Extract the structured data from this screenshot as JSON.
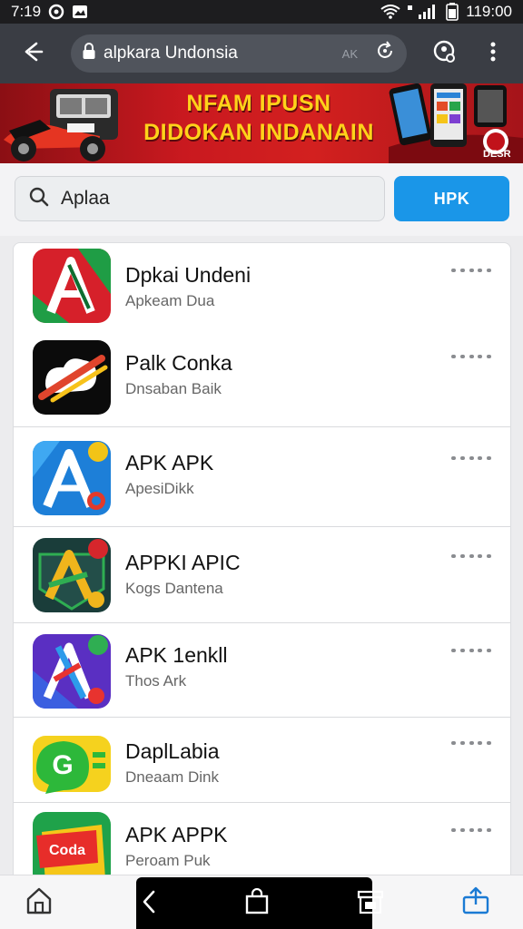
{
  "status_bar": {
    "time_left": "7:19",
    "time_right": "119:00"
  },
  "browser": {
    "url_text": "alpkara Undonsia",
    "url_aux": "AK",
    "icons": [
      "back-icon",
      "lock-icon",
      "refresh-icon",
      "profile-icon",
      "more-vertical-icon"
    ]
  },
  "banner": {
    "line1": "NFAM IPUSN",
    "line2": "DIDOKAN INDANAIN",
    "corner_tag": "DESR"
  },
  "search": {
    "value": "Aplaa",
    "button_label": "HPK"
  },
  "apps": [
    {
      "title": "Dpkai Undeni",
      "subtitle": "Apkeam Dua",
      "icon": "red-green-a-icon",
      "colors": [
        "#d6202a",
        "#1f9d45"
      ]
    },
    {
      "title": "Palk Conka",
      "subtitle": "Dnsaban Baik",
      "icon": "black-swoosh-icon",
      "colors": [
        "#000000",
        "#e0452d",
        "#f7c21a"
      ]
    },
    {
      "title": "APK APK",
      "subtitle": "ApesiDikk",
      "icon": "blue-a-icon",
      "colors": [
        "#1d7fd8",
        "#f2c417"
      ]
    },
    {
      "title": "APPKI APIC",
      "subtitle": "Kogs Dantena",
      "icon": "dark-green-a-icon",
      "colors": [
        "#1a3d3a",
        "#f0b51c",
        "#2fae52"
      ]
    },
    {
      "title": "APK 1enkll",
      "subtitle": "Thos Ark",
      "icon": "purple-a-icon",
      "colors": [
        "#5a2fc2",
        "#2d9bea",
        "#e8332f"
      ]
    },
    {
      "title": "DaplLabia",
      "subtitle": "Dneaam Dink",
      "icon": "green-chat-icon",
      "colors": [
        "#2db83a",
        "#f5d21e"
      ]
    },
    {
      "title": "APK APPK",
      "subtitle": "Peroam Puk",
      "icon": "red-yellow-folder-icon",
      "colors": [
        "#e72d2a",
        "#f5c619",
        "#1fa24a"
      ]
    }
  ],
  "bottom_nav": {
    "icons": [
      "home-icon",
      "back-arrow-icon",
      "bag-icon",
      "store-icon",
      "share-icon"
    ]
  }
}
